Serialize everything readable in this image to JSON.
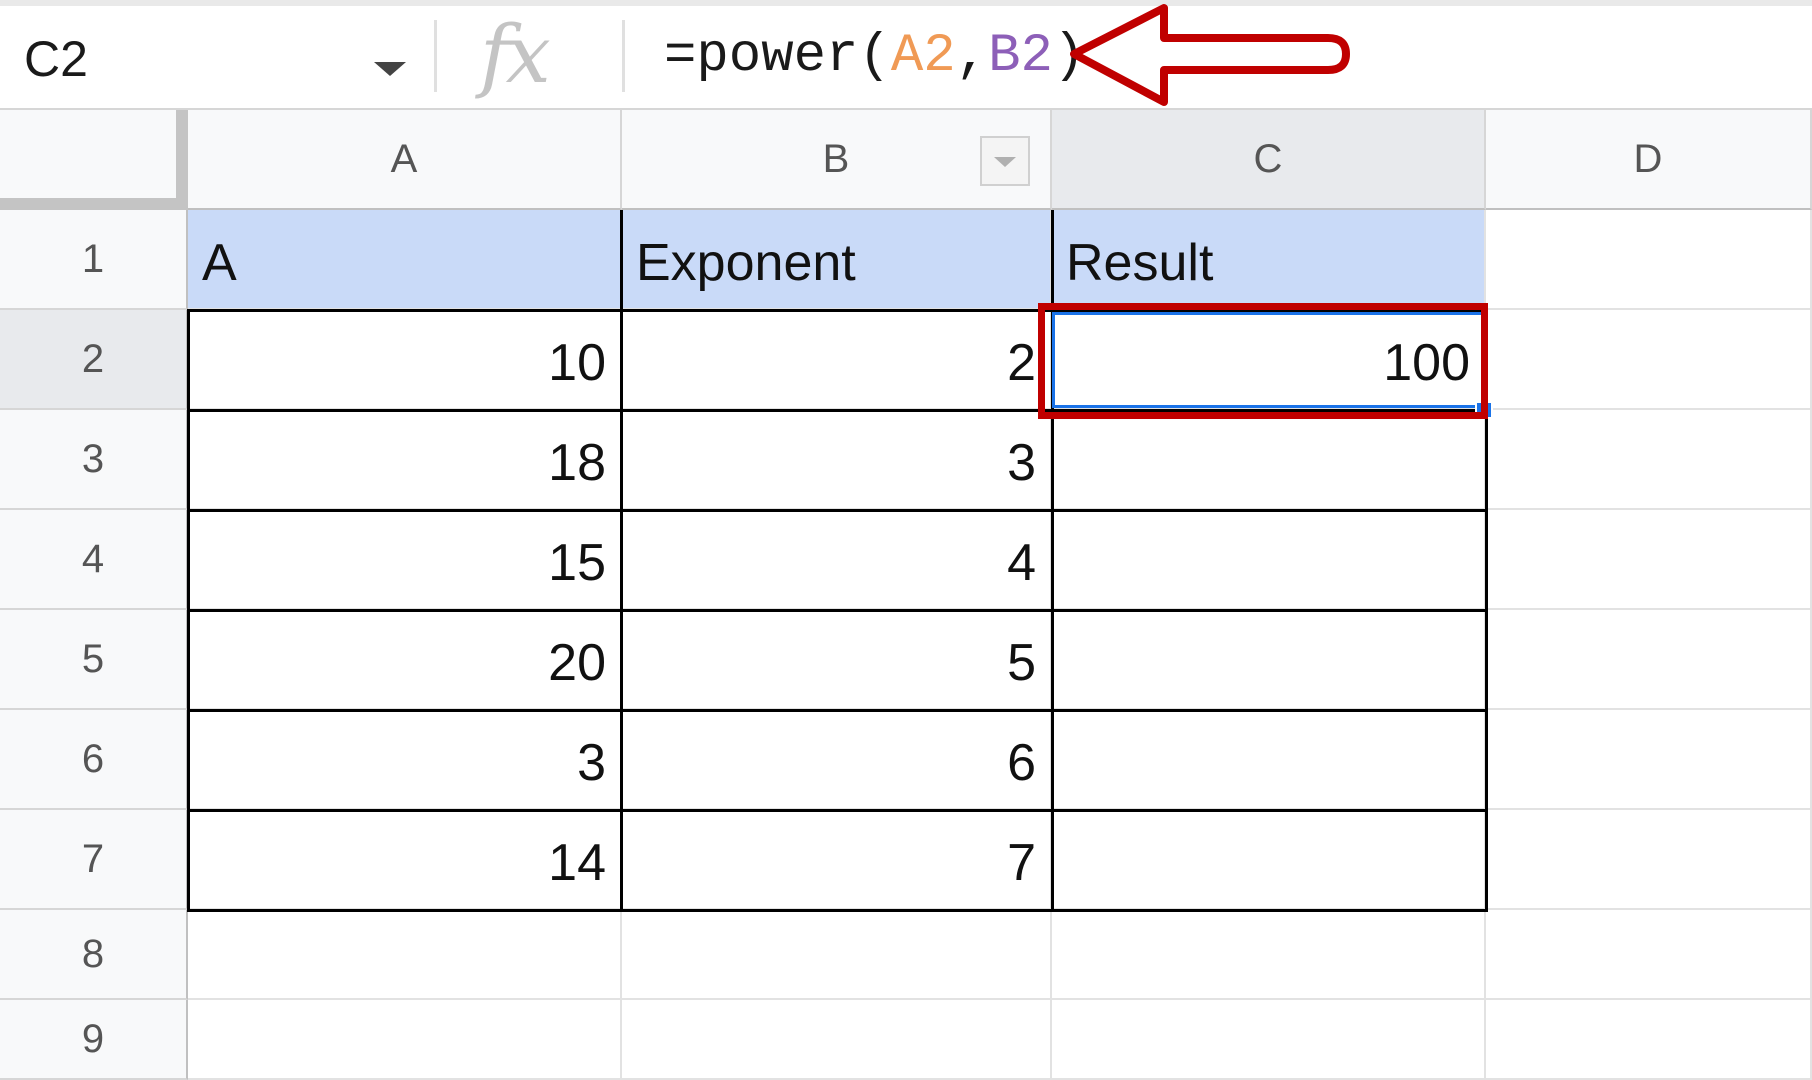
{
  "formula_bar": {
    "name_box": "C2",
    "fx_label": "fx",
    "formula_prefix": "=power(",
    "ref_a": "A2",
    "separator": ",",
    "ref_b": "B2",
    "formula_suffix": ")"
  },
  "columns": [
    "A",
    "B",
    "C",
    "D"
  ],
  "rows": [
    "1",
    "2",
    "3",
    "4",
    "5",
    "6",
    "7",
    "8",
    "9"
  ],
  "table": {
    "headers": [
      "A",
      "Exponent",
      "Result"
    ],
    "col_a": [
      "10",
      "18",
      "15",
      "20",
      "3",
      "14"
    ],
    "col_b": [
      "2",
      "3",
      "4",
      "5",
      "6",
      "7"
    ],
    "col_c": [
      "100",
      "",
      "",
      "",
      "",
      ""
    ]
  },
  "selection": {
    "active_cell": "C2"
  },
  "colors": {
    "header_fill": "#c9daf8",
    "selection_blue": "#1a73e8",
    "annotation_red": "#c00000",
    "ref_a_color": "#f09a55",
    "ref_b_color": "#8d5fb8"
  }
}
